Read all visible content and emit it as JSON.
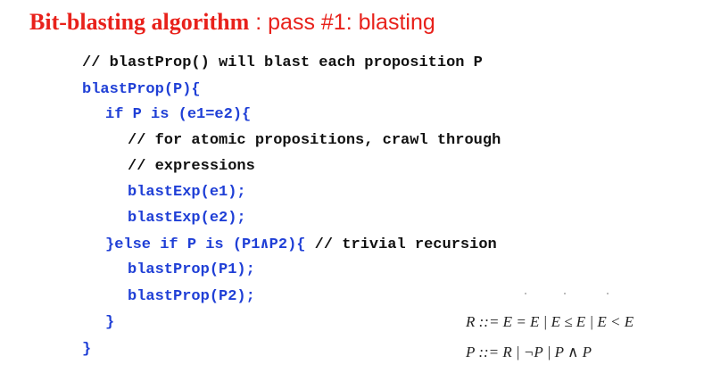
{
  "title": {
    "bold": "Bit-blasting algorithm",
    "rest": " : pass #1: blasting"
  },
  "code": {
    "l1": "// blastProp() will blast each proposition P",
    "l2": "blastProp(P){",
    "l3": "if P is (e1=e2){",
    "l4": "// for atomic propositions, crawl through",
    "l5": "// expressions",
    "l6": "blastExp(e1);",
    "l7": "blastExp(e2);",
    "l8_blue": "}else if P is (P1∧P2){",
    "l8_comment": " // trivial recursion",
    "l9": "blastProp(P1);",
    "l10": "blastProp(P2);",
    "l11": "}",
    "l12": "}"
  },
  "grammar": {
    "r_rule": "R ::= E = E | E ≤ E | E < E",
    "p_rule": "P ::= R | ¬P | P ∧ P"
  },
  "colors": {
    "title": "#e8211b",
    "code_blue": "#1f3fd6",
    "code_black": "#111111"
  }
}
